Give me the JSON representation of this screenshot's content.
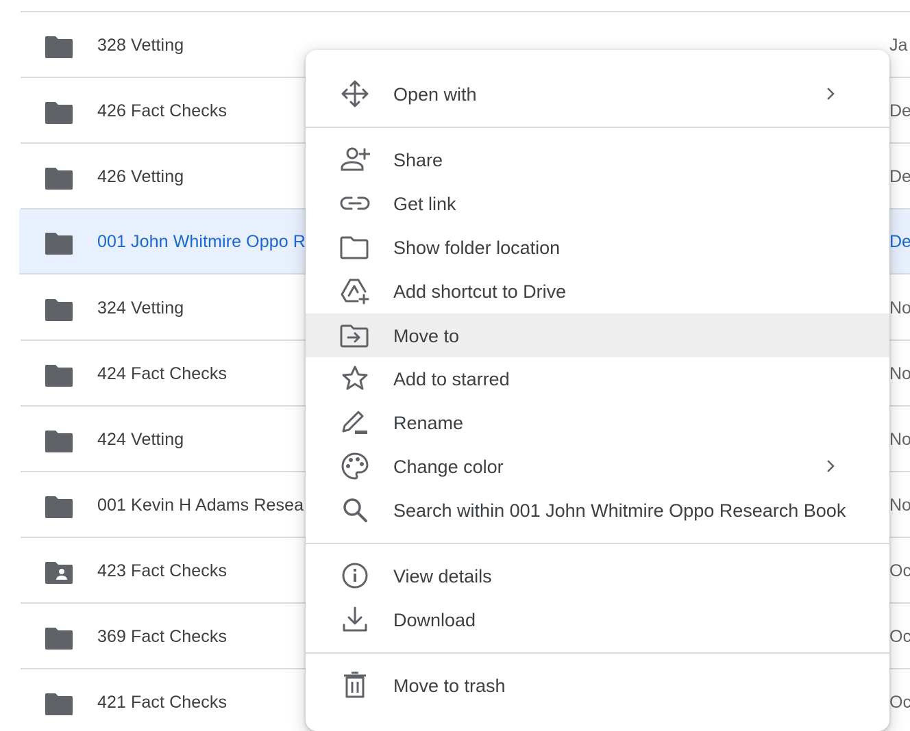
{
  "file_list": {
    "rows": [
      {
        "name": "328 Vetting",
        "date": "Ja",
        "icon": "folder-icon",
        "selected": false
      },
      {
        "name": "426 Fact Checks",
        "date": "De",
        "icon": "folder-icon",
        "selected": false
      },
      {
        "name": "426 Vetting",
        "date": "De",
        "icon": "folder-icon",
        "selected": false
      },
      {
        "name": "001 John Whitmire Oppo R",
        "date": "De",
        "icon": "folder-icon",
        "selected": true
      },
      {
        "name": "324 Vetting",
        "date": "No",
        "icon": "folder-icon",
        "selected": false
      },
      {
        "name": "424 Fact Checks",
        "date": "No",
        "icon": "folder-icon",
        "selected": false
      },
      {
        "name": "424 Vetting",
        "date": "No",
        "icon": "folder-icon",
        "selected": false
      },
      {
        "name": "001 Kevin H Adams Resea",
        "date": "No",
        "icon": "folder-icon",
        "selected": false
      },
      {
        "name": "423 Fact Checks",
        "date": "Oc",
        "icon": "shared-folder-icon",
        "selected": false
      },
      {
        "name": "369 Fact Checks",
        "date": "Oc",
        "icon": "folder-icon",
        "selected": false
      },
      {
        "name": "421 Fact Checks",
        "date": "Oc",
        "icon": "folder-icon",
        "selected": false
      }
    ]
  },
  "context_menu": {
    "open_with": "Open with",
    "share": "Share",
    "get_link": "Get link",
    "show_folder_location": "Show folder location",
    "add_shortcut": "Add shortcut to Drive",
    "move_to": "Move to",
    "add_starred": "Add to starred",
    "rename": "Rename",
    "change_color": "Change color",
    "search_within": "Search within 001 John Whitmire Oppo Research Book",
    "view_details": "View details",
    "download": "Download",
    "move_to_trash": "Move to trash",
    "highlighted_item": "Move to"
  },
  "colors": {
    "selected_row_bg": "#e8f0fe",
    "selected_text": "#1967d2",
    "text": "#3c4043",
    "icon": "#5f6368",
    "divider": "#dadce0",
    "highlight": "#eeeeee"
  }
}
